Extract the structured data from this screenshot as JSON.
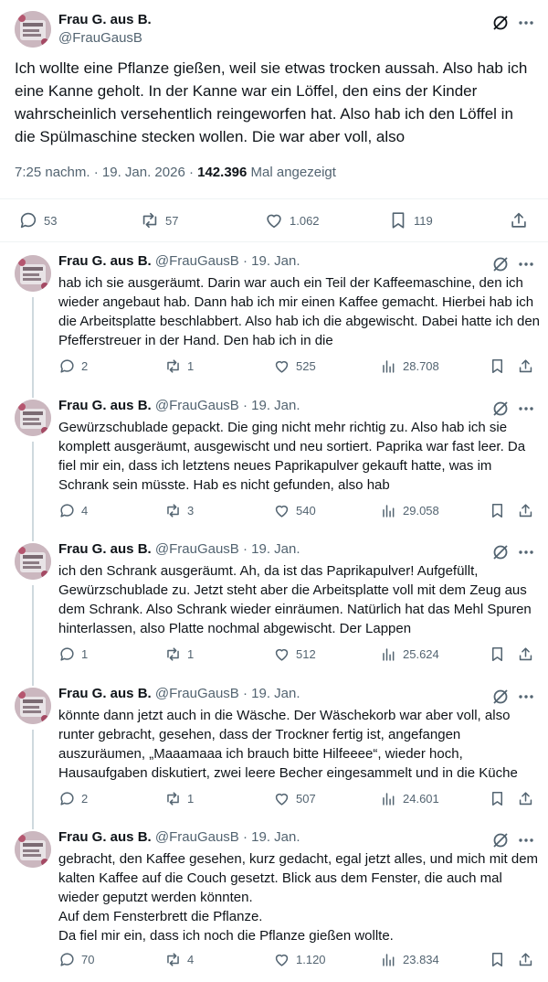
{
  "main": {
    "author_name": "Frau G. aus B.",
    "author_handle": "@FrauGausB",
    "text": "Ich wollte eine Pflanze gießen, weil sie etwas trocken aussah. Also hab ich eine Kanne geholt. In der Kanne war ein Löffel, den eins der Kinder wahrscheinlich versehentlich reingeworfen hat. Also hab ich den Löffel in die Spülmaschine stecken wollen. Die war aber voll, also",
    "time": "7:25 nachm. · 19. Jan. 2026 · ",
    "views_count": "142.396",
    "views_label": " Mal angezeigt",
    "replies": "53",
    "reposts": "57",
    "likes": "1.062",
    "bookmarks": "119"
  },
  "replies": [
    {
      "author_name": "Frau G. aus B.",
      "meta": "@FrauGausB · 19. Jan.",
      "text": "hab ich sie ausgeräumt. Darin war auch ein Teil der Kaffeemaschine, den ich wieder angebaut hab. Dann hab ich mir einen Kaffee gemacht. Hierbei hab ich die Arbeitsplatte beschlabbert. Also hab ich die abgewischt. Dabei hatte ich den Pfefferstreuer in der Hand. Den hab ich in die",
      "replies": "2",
      "reposts": "1",
      "likes": "525",
      "views": "28.708"
    },
    {
      "author_name": "Frau G. aus B.",
      "meta": "@FrauGausB · 19. Jan.",
      "text": "Gewürzschublade gepackt. Die ging nicht mehr richtig zu. Also hab ich sie komplett ausgeräumt, ausgewischt und neu sortiert. Paprika war fast leer. Da fiel mir ein, dass ich letztens neues Paprikapulver gekauft hatte, was im Schrank sein müsste. Hab es nicht gefunden, also hab",
      "replies": "4",
      "reposts": "3",
      "likes": "540",
      "views": "29.058"
    },
    {
      "author_name": "Frau G. aus B.",
      "meta": "@FrauGausB · 19. Jan.",
      "text": "ich den Schrank ausgeräumt. Ah, da ist das Paprikapulver! Aufgefüllt, Gewürzschublade zu. Jetzt steht aber die Arbeitsplatte voll mit dem Zeug aus dem Schrank. Also Schrank wieder einräumen. Natürlich hat das Mehl Spuren hinterlassen, also Platte nochmal abgewischt. Der Lappen",
      "replies": "1",
      "reposts": "1",
      "likes": "512",
      "views": "25.624"
    },
    {
      "author_name": "Frau G. aus B.",
      "meta": "@FrauGausB · 19. Jan.",
      "text": "könnte dann jetzt auch in die Wäsche. Der Wäschekorb war aber voll, also runter gebracht, gesehen, dass der Trockner fertig ist, angefangen auszuräumen, „Maaamaaa ich brauch bitte Hilfeeee“, wieder hoch, Hausaufgaben diskutiert, zwei leere Becher eingesammelt und in die Küche",
      "replies": "2",
      "reposts": "1",
      "likes": "507",
      "views": "24.601"
    },
    {
      "author_name": "Frau G. aus B.",
      "meta": "@FrauGausB · 19. Jan.",
      "text": "gebracht, den Kaffee gesehen, kurz gedacht, egal jetzt alles, und mich mit dem kalten Kaffee auf die Couch gesetzt. Blick aus dem Fenster, die auch mal wieder geputzt werden könnten.\nAuf dem Fensterbrett die Pflanze.\nDa fiel mir ein, dass ich noch die Pflanze gießen wollte.",
      "replies": "70",
      "reposts": "4",
      "likes": "1.120",
      "views": "23.834"
    }
  ]
}
